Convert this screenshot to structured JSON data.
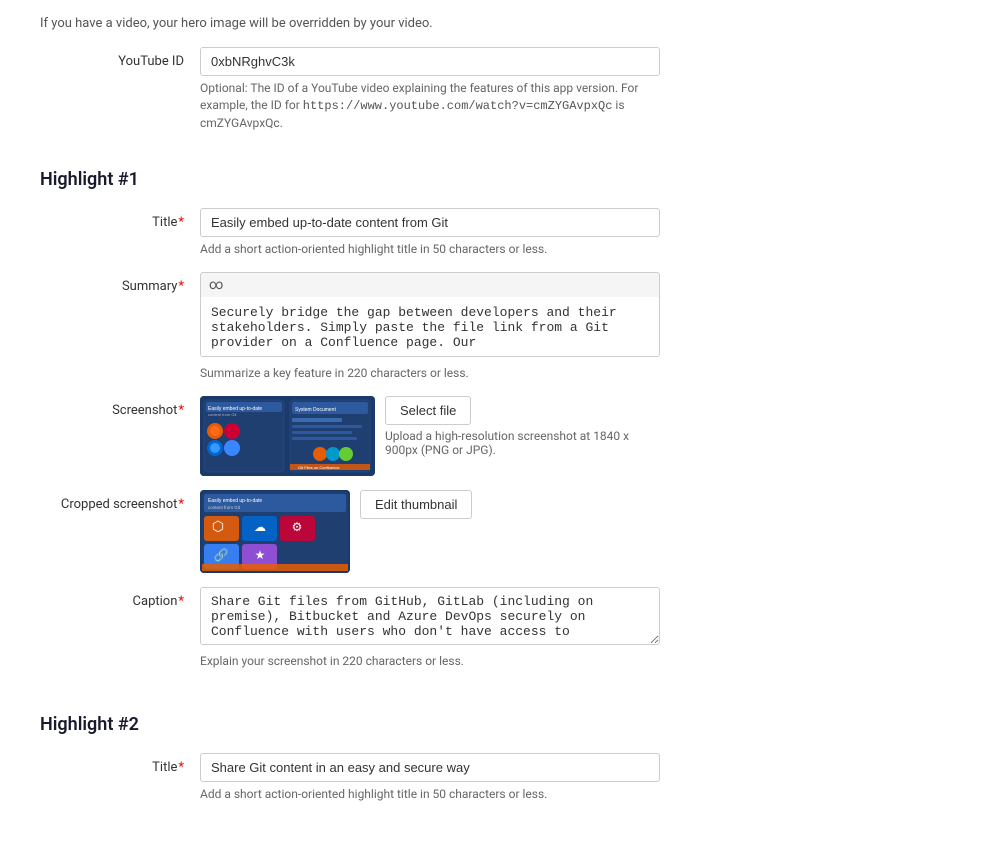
{
  "page": {
    "top_notice": "If you have a video, your hero image will be overridden by your video.",
    "youtube_id_label": "YouTube ID",
    "youtube_id_value": "0xbNRghvC3k",
    "youtube_id_hint_1": "Optional: The ID of a YouTube video explaining the features of this app version. For example, the ID for",
    "youtube_id_hint_code": "https://www.youtube.com/watch?v=cmZYGAvpxQc",
    "youtube_id_hint_2": "is cmZYGAvpxQc.",
    "highlight1": {
      "heading": "Highlight #1",
      "title_label": "Title",
      "title_value": "Easily embed up-to-date content from Git",
      "title_hint": "Add a short action-oriented highlight title in 50 characters or less.",
      "summary_label": "Summary",
      "summary_text": "Securely bridge the gap between developers and their stakeholders. Simply paste the file link from a Git provider on a Confluence page. Our",
      "summary_hint": "Summarize a key feature in 220 characters or less.",
      "screenshot_label": "Screenshot",
      "select_file_btn": "Select file",
      "upload_hint": "Upload a high-resolution screenshot at 1840 x 900px (PNG or JPG).",
      "cropped_screenshot_label": "Cropped screenshot",
      "edit_thumbnail_btn": "Edit thumbnail",
      "caption_label": "Caption",
      "caption_value": "Share Git files from GitHub, GitLab (including on premise), Bitbucket and Azure DevOps securely on Confluence with users who don't have access to",
      "caption_hint": "Explain your screenshot in 220 characters or less."
    },
    "highlight2": {
      "heading": "Highlight #2",
      "title_label": "Title",
      "title_value": "Share Git content in an easy and secure way",
      "title_hint": "Add a short action-oriented highlight title in 50 characters or less."
    }
  }
}
